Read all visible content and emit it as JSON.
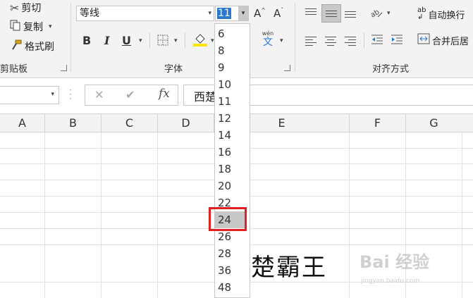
{
  "clipboard": {
    "cut_label": "剪切",
    "copy_label": "复制",
    "format_painter_label": "格式刷",
    "group_label": "剪贴板"
  },
  "font": {
    "font_name": "等线",
    "font_size": "11",
    "group_label": "字体",
    "increase_label": "A",
    "decrease_label": "A",
    "bold_label": "B",
    "italic_label": "I",
    "underline_label": "U",
    "phonetic_top": "wén",
    "phonetic_bottom": "文"
  },
  "alignment": {
    "wrap_text_label": "自动换行",
    "merge_label": "合并后居",
    "group_label": "对齐方式",
    "wrap_icon_text": "ab"
  },
  "formula_bar": {
    "cancel_symbol": "✕",
    "enter_symbol": "✔",
    "fx_label": "fx",
    "content": "西楚"
  },
  "columns": [
    "A",
    "B",
    "C",
    "D",
    "E",
    "F",
    "G"
  ],
  "font_size_dropdown": {
    "options": [
      "6",
      "8",
      "9",
      "10",
      "11",
      "12",
      "14",
      "16",
      "18",
      "20",
      "22",
      "24",
      "26",
      "28",
      "36",
      "48"
    ],
    "highlighted": "24"
  },
  "cell": {
    "text": "楚霸王"
  },
  "watermark": {
    "text": "Bai 经验",
    "url": "jingyan.baidu.com"
  },
  "colors": {
    "accent_highlight": "#e02020",
    "ribbon_bg": "#f3f3f3",
    "selected_item_bg": "#c8c8c8",
    "font_size_selection": "#2b79d0"
  }
}
